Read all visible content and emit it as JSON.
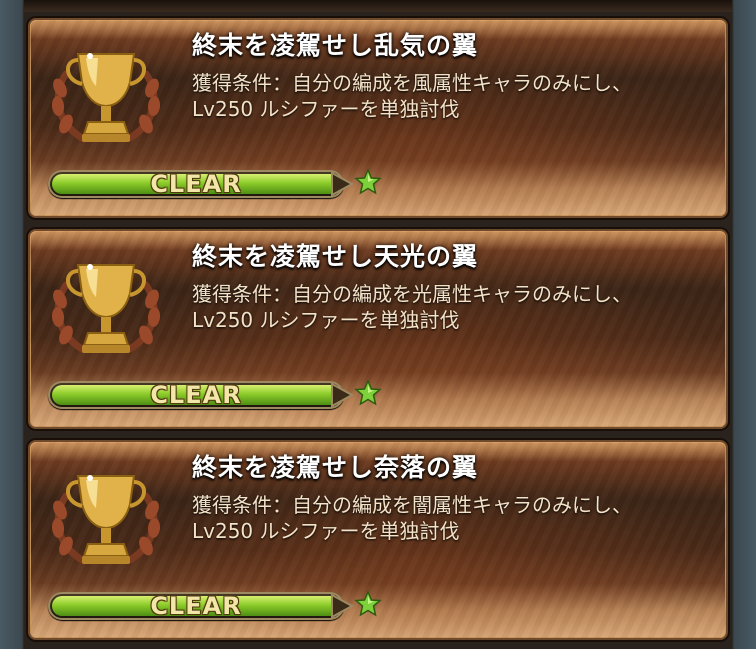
{
  "achievements": [
    {
      "title": "終末を凌駕せし乱気の翼",
      "condition_line1": "獲得条件：自分の編成を風属性キャラのみにし、",
      "condition_line2": "Lv250 ルシファーを単独討伐",
      "status": "CLEAR",
      "progress": 1.0
    },
    {
      "title": "終末を凌駕せし天光の翼",
      "condition_line1": "獲得条件：自分の編成を光属性キャラのみにし、",
      "condition_line2": "Lv250 ルシファーを単独討伐",
      "status": "CLEAR",
      "progress": 1.0
    },
    {
      "title": "終末を凌駕せし奈落の翼",
      "condition_line1": "獲得条件：自分の編成を闇属性キャラのみにし、",
      "condition_line2": "Lv250 ルシファーを単独討伐",
      "status": "CLEAR",
      "progress": 1.0
    }
  ],
  "icons": {
    "trophy": "gold-trophy-icon",
    "star": "green-star-icon"
  },
  "colors": {
    "progress_fill": "#8ccc2a",
    "star": "#7fd13b",
    "trophy_gold": "#e8b84a"
  }
}
